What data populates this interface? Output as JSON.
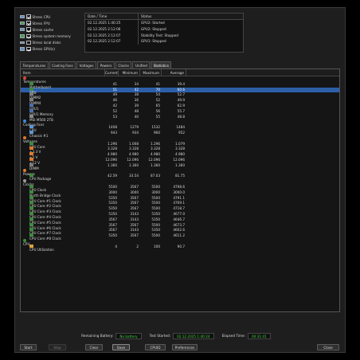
{
  "stress_options": [
    {
      "label": "Stress CPU",
      "checked": true,
      "icon": "cpu-icon"
    },
    {
      "label": "Stress FPU",
      "checked": true,
      "icon": "fpu-icon"
    },
    {
      "label": "Stress cache",
      "checked": true,
      "icon": "cache-icon"
    },
    {
      "label": "Stress system memory",
      "checked": true,
      "icon": "memory-icon"
    },
    {
      "label": "Stress local disks",
      "checked": false,
      "icon": "disk-icon"
    },
    {
      "label": "Stress GPU(s)",
      "checked": true,
      "icon": "gpu-icon"
    }
  ],
  "log": {
    "headers": [
      "Date / Time",
      "Status"
    ],
    "rows": [
      {
        "time": "02.12.2025 1:40:25",
        "status": "GPU2: Started"
      },
      {
        "time": "02.12.2025 2:12:06",
        "status": "GPU2: Stopped"
      },
      {
        "time": "02.12.2025 2:12:07",
        "status": "Stability Test: Stopped"
      },
      {
        "time": "02.12.2025 2:12:07",
        "status": "GPU1: Stopped"
      }
    ]
  },
  "tabs": [
    "Temperatures",
    "Cooling Fans",
    "Voltages",
    "Powers",
    "Clocks",
    "Unified",
    "Statistics"
  ],
  "active_tab": "Statistics",
  "table": {
    "headers": {
      "item": "Item",
      "current": "Current",
      "minimum": "Minimum",
      "maximum": "Maximum",
      "average": "Average"
    },
    "rows": [
      {
        "type": "group",
        "name": "Temperatures",
        "icon": "thermometer-icon",
        "color": "#d94a3a"
      },
      {
        "type": "item",
        "name": "Motherboard",
        "cur": "41",
        "min": "34",
        "max": "41",
        "avg": "39.4",
        "color": "#3d8b3d"
      },
      {
        "type": "item",
        "name": "CPU",
        "cur": "51",
        "min": "42",
        "max": "70",
        "avg": "60.6",
        "color": "#3d8b3d",
        "selected": true
      },
      {
        "type": "item",
        "name": "DIMM2",
        "cur": "49",
        "min": "38",
        "max": "54",
        "avg": "52.7",
        "color": "#7d7d7d"
      },
      {
        "type": "item",
        "name": "DIMM4",
        "cur": "46",
        "min": "36",
        "max": "52",
        "avg": "49.9",
        "color": "#7d7d7d"
      },
      {
        "type": "item",
        "name": "GPU1",
        "cur": "42",
        "min": "39",
        "max": "65",
        "avg": "62.9",
        "color": "#4a6fae"
      },
      {
        "type": "item",
        "name": "GPU1 Memory",
        "cur": "52",
        "min": "48",
        "max": "56",
        "avg": "55.7",
        "color": "#4a6fae"
      },
      {
        "type": "item",
        "name": "MSI M560 2TB",
        "cur": "53",
        "min": "40",
        "max": "55",
        "avg": "48.8",
        "color": "#8a8a8a"
      },
      {
        "type": "group",
        "name": "Cooling Fans",
        "icon": "fan-icon",
        "color": "#3a8ad9"
      },
      {
        "type": "item",
        "name": "CPU",
        "cur": "1408",
        "min": "1279",
        "max": "1532",
        "avg": "1484",
        "color": "#5a9ad9"
      },
      {
        "type": "item",
        "name": "Chassis #1",
        "cur": "943",
        "min": "934",
        "max": "960",
        "avg": "952",
        "color": "#5a9ad9"
      },
      {
        "type": "group",
        "name": "Voltages",
        "icon": "voltage-icon",
        "color": "#e07a2a"
      },
      {
        "type": "item",
        "name": "CPU Core",
        "cur": "1.296",
        "min": "1.008",
        "max": "1.296",
        "avg": "1.079",
        "color": "#3d8b3d"
      },
      {
        "type": "item",
        "name": "+3.3 V",
        "cur": "3.328",
        "min": "3.328",
        "max": "3.328",
        "avg": "3.328",
        "color": "#e07a2a"
      },
      {
        "type": "item",
        "name": "+5 V",
        "cur": "4.980",
        "min": "4.980",
        "max": "4.980",
        "avg": "4.980",
        "color": "#e07a2a"
      },
      {
        "type": "item",
        "name": "+12 V",
        "cur": "12.096",
        "min": "12.096",
        "max": "12.096",
        "avg": "12.096",
        "color": "#e07a2a"
      },
      {
        "type": "item",
        "name": "DIMM",
        "cur": "1.360",
        "min": "1.360",
        "max": "1.360",
        "avg": "1.360",
        "color": "#7d7d7d"
      },
      {
        "type": "group",
        "name": "Powers",
        "icon": "power-icon",
        "color": "#e07a2a"
      },
      {
        "type": "item",
        "name": "CPU Package",
        "cur": "42.59",
        "min": "33.54",
        "max": "87.03",
        "avg": "81.75",
        "color": "#3d8b3d"
      },
      {
        "type": "group",
        "name": "Clocks",
        "icon": "clock-icon",
        "color": "#9a9a9a"
      },
      {
        "type": "item",
        "name": "CPU Clock",
        "cur": "5500",
        "min": "3567",
        "max": "5500",
        "avg": "4798.6",
        "color": "#3d8b3d"
      },
      {
        "type": "item",
        "name": "North Bridge Clock",
        "cur": "3000",
        "min": "3000",
        "max": "3000",
        "avg": "3000.0",
        "color": "#3d8b3d"
      },
      {
        "type": "item",
        "name": "CPU Core #1 Clock",
        "cur": "5350",
        "min": "3567",
        "max": "5500",
        "avg": "4791.1",
        "color": "#3d8b3d"
      },
      {
        "type": "item",
        "name": "CPU Core #2 Clock",
        "cur": "5350",
        "min": "3567",
        "max": "5500",
        "avg": "4769.1",
        "color": "#3d8b3d"
      },
      {
        "type": "item",
        "name": "CPU Core #3 Clock",
        "cur": "5350",
        "min": "3567",
        "max": "5500",
        "avg": "4718.7",
        "color": "#3d8b3d"
      },
      {
        "type": "item",
        "name": "CPU Core #4 Clock",
        "cur": "5350",
        "min": "3143",
        "max": "5350",
        "avg": "4677.0",
        "color": "#3d8b3d"
      },
      {
        "type": "item",
        "name": "CPU Core #5 Clock",
        "cur": "3567",
        "min": "3143",
        "max": "5350",
        "avg": "4646.7",
        "color": "#3d8b3d"
      },
      {
        "type": "item",
        "name": "CPU Core #6 Clock",
        "cur": "3567",
        "min": "3567",
        "max": "5500",
        "avg": "4673.7",
        "color": "#3d8b3d"
      },
      {
        "type": "item",
        "name": "CPU Core #7 Clock",
        "cur": "3567",
        "min": "3143",
        "max": "5350",
        "avg": "4602.6",
        "color": "#3d8b3d"
      },
      {
        "type": "item",
        "name": "CPU Core #8 Clock",
        "cur": "5350",
        "min": "3567",
        "max": "5500",
        "avg": "4611.2",
        "color": "#3d8b3d"
      },
      {
        "type": "group",
        "name": "CPU",
        "icon": "cpu-group-icon",
        "color": "#3d8b3d"
      },
      {
        "type": "item",
        "name": "CPU Utilization",
        "cur": "4",
        "min": "2",
        "max": "100",
        "avg": "90.7",
        "color": "#d9a23a"
      }
    ]
  },
  "status": {
    "battery_label": "Remaining Battery:",
    "battery_value": "No battery",
    "started_label": "Test Started:",
    "started_value": "02.12.2025 1:40:24",
    "elapsed_label": "Elapsed Time:",
    "elapsed_value": "00:31:41"
  },
  "buttons": {
    "start": "Start",
    "stop": "Stop",
    "clear": "Clear",
    "save": "Save",
    "cpuid": "CPUID",
    "preferences": "Preferences",
    "close": "Close"
  },
  "colors": {
    "accent": "#2d5fa8",
    "status_value": "#3fd13f"
  }
}
